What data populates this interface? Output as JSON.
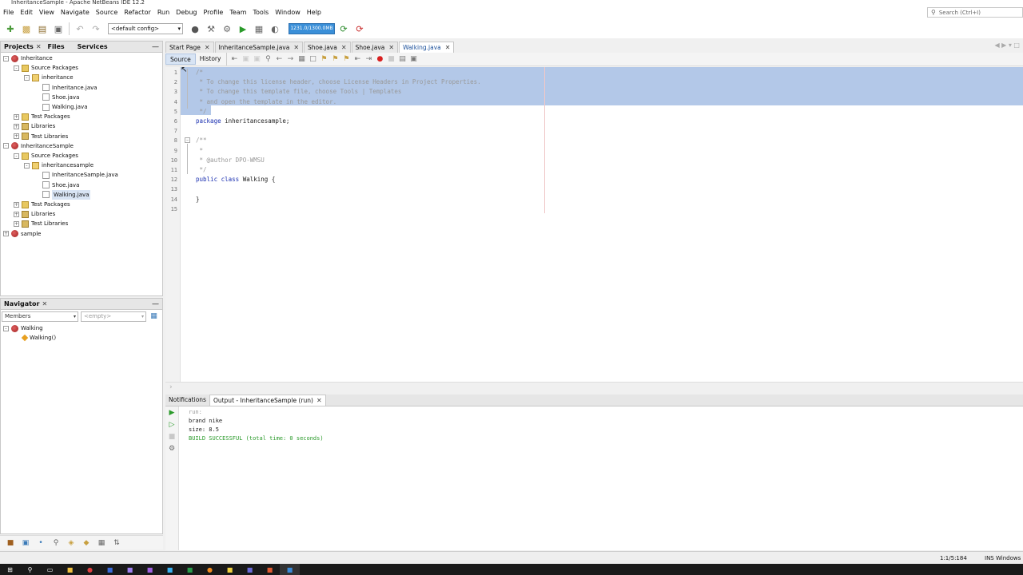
{
  "window": {
    "title": "InheritanceSample - Apache NetBeans IDE 12.2"
  },
  "menu": [
    "File",
    "Edit",
    "View",
    "Navigate",
    "Source",
    "Refactor",
    "Run",
    "Debug",
    "Profile",
    "Team",
    "Tools",
    "Window",
    "Help"
  ],
  "search": {
    "placeholder": "Search (Ctrl+I)"
  },
  "toolbar": {
    "config": "<default config>",
    "memory": "1231.0/1300.0MB"
  },
  "projects_panel": {
    "tabs": [
      "Projects",
      "Files",
      "Services"
    ],
    "tree": [
      {
        "label": "Inheritance",
        "icon": "project-icon",
        "depth": 0,
        "expander": "-"
      },
      {
        "label": "Source Packages",
        "icon": "folder-icon",
        "depth": 1,
        "expander": "-"
      },
      {
        "label": "inheritance",
        "icon": "package-icon",
        "depth": 2,
        "expander": "-"
      },
      {
        "label": "Inheritance.java",
        "icon": "java-file-icon",
        "depth": 3,
        "expander": ""
      },
      {
        "label": "Shoe.java",
        "icon": "java-file-icon",
        "depth": 3,
        "expander": ""
      },
      {
        "label": "Walking.java",
        "icon": "java-file-icon",
        "depth": 3,
        "expander": ""
      },
      {
        "label": "Test Packages",
        "icon": "folder-icon",
        "depth": 1,
        "expander": "+"
      },
      {
        "label": "Libraries",
        "icon": "library-icon",
        "depth": 1,
        "expander": "+"
      },
      {
        "label": "Test Libraries",
        "icon": "library-icon",
        "depth": 1,
        "expander": "+"
      },
      {
        "label": "InheritanceSample",
        "icon": "project-icon",
        "depth": 0,
        "expander": "-"
      },
      {
        "label": "Source Packages",
        "icon": "folder-icon",
        "depth": 1,
        "expander": "-"
      },
      {
        "label": "inheritancesample",
        "icon": "package-icon",
        "depth": 2,
        "expander": "-"
      },
      {
        "label": "InheritanceSample.java",
        "icon": "java-file-icon",
        "depth": 3,
        "expander": ""
      },
      {
        "label": "Shoe.java",
        "icon": "java-file-icon",
        "depth": 3,
        "expander": ""
      },
      {
        "label": "Walking.java",
        "icon": "java-file-icon",
        "depth": 3,
        "expander": "",
        "selected": true
      },
      {
        "label": "Test Packages",
        "icon": "folder-icon",
        "depth": 1,
        "expander": "+"
      },
      {
        "label": "Libraries",
        "icon": "library-icon",
        "depth": 1,
        "expander": "+"
      },
      {
        "label": "Test Libraries",
        "icon": "library-icon",
        "depth": 1,
        "expander": "+"
      },
      {
        "label": "sample",
        "icon": "project-icon",
        "depth": 0,
        "expander": "+"
      }
    ]
  },
  "navigator": {
    "title": "Navigator",
    "filter": "Members",
    "empty": "<empty>",
    "tree": [
      {
        "label": "Walking",
        "icon": "class-icon",
        "depth": 0
      },
      {
        "label": "Walking()",
        "icon": "constructor-icon",
        "depth": 1
      }
    ]
  },
  "editor": {
    "tabs": [
      {
        "label": "Start Page",
        "active": false
      },
      {
        "label": "InheritanceSample.java",
        "active": false
      },
      {
        "label": "Shoe.java",
        "active": false
      },
      {
        "label": "Shoe.java",
        "active": false
      },
      {
        "label": "Walking.java",
        "active": true
      }
    ],
    "source_label": "Source",
    "history_label": "History",
    "lines": [
      {
        "n": "1",
        "text": "/*",
        "cls": "cmt"
      },
      {
        "n": "2",
        "text": " * To change this license header, choose License Headers in Project Properties.",
        "cls": "cmt"
      },
      {
        "n": "3",
        "text": " * To change this template file, choose Tools | Templates",
        "cls": "cmt"
      },
      {
        "n": "4",
        "text": " * and open the template in the editor.",
        "cls": "cmt"
      },
      {
        "n": "5",
        "text": " */",
        "cls": "cmt"
      },
      {
        "n": "6",
        "text": "package inheritancesample;",
        "cls": ""
      },
      {
        "n": "7",
        "text": "",
        "cls": ""
      },
      {
        "n": "8",
        "text": "/**",
        "cls": "cmt"
      },
      {
        "n": "9",
        "text": " *",
        "cls": "cmt"
      },
      {
        "n": "10",
        "text": " * @author DPO-WMSU",
        "cls": "cmt"
      },
      {
        "n": "11",
        "text": " */",
        "cls": "cmt"
      },
      {
        "n": "12",
        "text": "public class Walking {",
        "cls": ""
      },
      {
        "n": "13",
        "text": "",
        "cls": ""
      },
      {
        "n": "14",
        "text": "}",
        "cls": ""
      },
      {
        "n": "15",
        "text": "",
        "cls": ""
      }
    ]
  },
  "output": {
    "tabs": [
      "Notifications",
      "Output - InheritanceSample (run)"
    ],
    "lines": [
      {
        "text": "run:",
        "color": "#999999"
      },
      {
        "text": "brand nike",
        "color": "#222222"
      },
      {
        "text": "size: 8.5",
        "color": "#222222"
      },
      {
        "text": "BUILD SUCCESSFUL (total time: 0 seconds)",
        "color": "#2a9a2a"
      }
    ]
  },
  "status": {
    "position": "1:1/5:184",
    "mode": "INS",
    "eol": "Windows"
  }
}
